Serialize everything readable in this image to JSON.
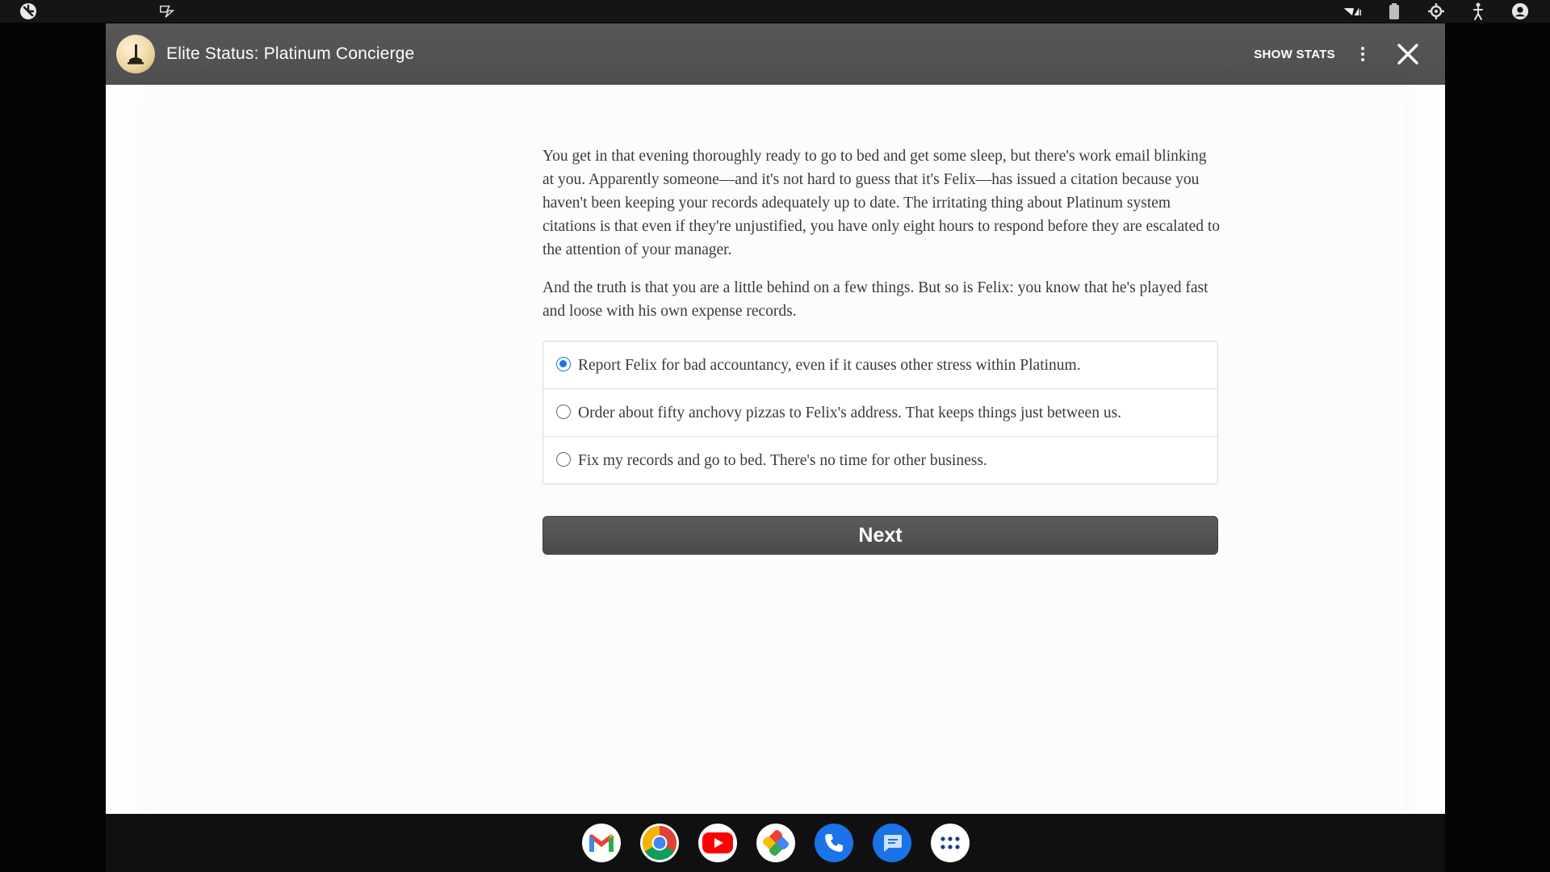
{
  "status_bar": {
    "left_icons": [
      "app-launcher-icon",
      "notification-icon"
    ],
    "right_icons": [
      "wifi-icon",
      "battery-icon",
      "settings-icon",
      "accessibility-icon",
      "account-icon"
    ]
  },
  "window": {
    "title": "Elite Status: Platinum Concierge",
    "show_stats_label": "SHOW STATS"
  },
  "story": {
    "paragraphs": [
      "You get in that evening thoroughly ready to go to bed and get some sleep, but there's work email blinking at you. Apparently someone—and it's not hard to guess that it's Felix—has issued a citation because you haven't been keeping your records adequately up to date. The irritating thing about Platinum system citations is that even if they're unjustified, you have only eight hours to respond before they are escalated to the attention of your manager.",
      "And the truth is that you are a little behind on a few things. But so is Felix: you know that he's played fast and loose with his own expense records."
    ]
  },
  "choices": [
    {
      "label": "Report Felix for bad accountancy, even if it causes other stress within Platinum.",
      "selected": true
    },
    {
      "label": "Order about fifty anchovy pizzas to Felix's address. That keeps things just between us.",
      "selected": false
    },
    {
      "label": "Fix my records and go to bed. There's no time for other business.",
      "selected": false
    }
  ],
  "next_button": {
    "label": "Next"
  },
  "shelf": {
    "apps": [
      "gmail-icon",
      "chrome-icon",
      "youtube-icon",
      "photos-icon",
      "phone-icon",
      "messages-icon",
      "app-grid-icon"
    ]
  },
  "colors": {
    "app_bar": "#525252",
    "radio_selected": "#1a73e8",
    "next_button": "#505050"
  }
}
